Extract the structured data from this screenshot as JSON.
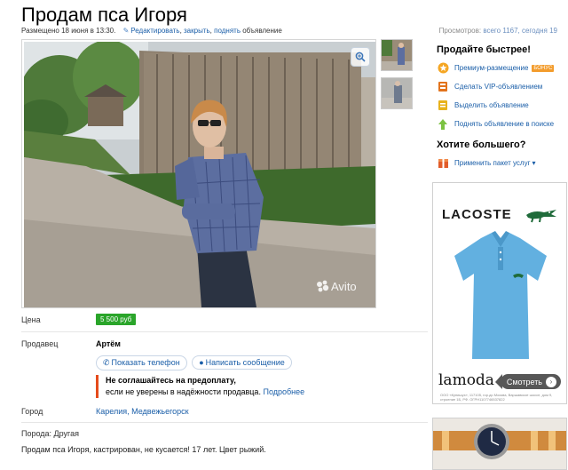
{
  "header": {
    "title": "Продам пса Игоря",
    "posted": "Размещено 18 июня в 13:30.",
    "edit_link": "Редактировать",
    "close_link": "закрыть",
    "raise_link": "поднять",
    "raise_suffix": "объявление",
    "views_label": "Просмотров:",
    "views_total": "всего 1167, сегодня 19"
  },
  "gallery": {
    "watermark": "Avito"
  },
  "details": {
    "price_label": "Цена",
    "price_value": "5 500 руб",
    "seller_label": "Продавец",
    "seller_name": "Артём",
    "show_phone": "Показать телефон",
    "write_message": "Написать сообщение",
    "warning_bold": "Не соглашайтесь на предоплату,",
    "warning_text": "если не уверены в надёжности продавца.",
    "warning_link": "Подробнее",
    "city_label": "Город",
    "city_value": "Карелия, Медвежьегорск",
    "breed": "Порода: Другая",
    "description": "Продам пса Игоря, кастрирован, не кусается! 17 лет. Цвет рыжий."
  },
  "sidebar": {
    "title": "Продайте быстрее!",
    "items": [
      {
        "label": "Премиум-размещение",
        "badge": "БОНУС",
        "icon": "star-icon",
        "color": "#f5a623"
      },
      {
        "label": "Сделать VIP-объявлением",
        "icon": "vip-icon",
        "color": "#e2731c"
      },
      {
        "label": "Выделить объявление",
        "icon": "highlight-icon",
        "color": "#e8b21c"
      },
      {
        "label": "Поднять объявление в поиске",
        "icon": "up-arrow-icon",
        "color": "#7cc242"
      }
    ],
    "more_title": "Хотите большего?",
    "package_label": "Применить пакет услуг",
    "package_icon": "package-icon"
  },
  "ad": {
    "brand": "LACOSTE",
    "shop": "lamoda",
    "button": "Смотреть",
    "legal": "ООО «Купишуз», 117105, гор.до Москва, Варшавское шоссе, дом 9, строение 1Б, РФ. ОГРН1107746537822"
  }
}
